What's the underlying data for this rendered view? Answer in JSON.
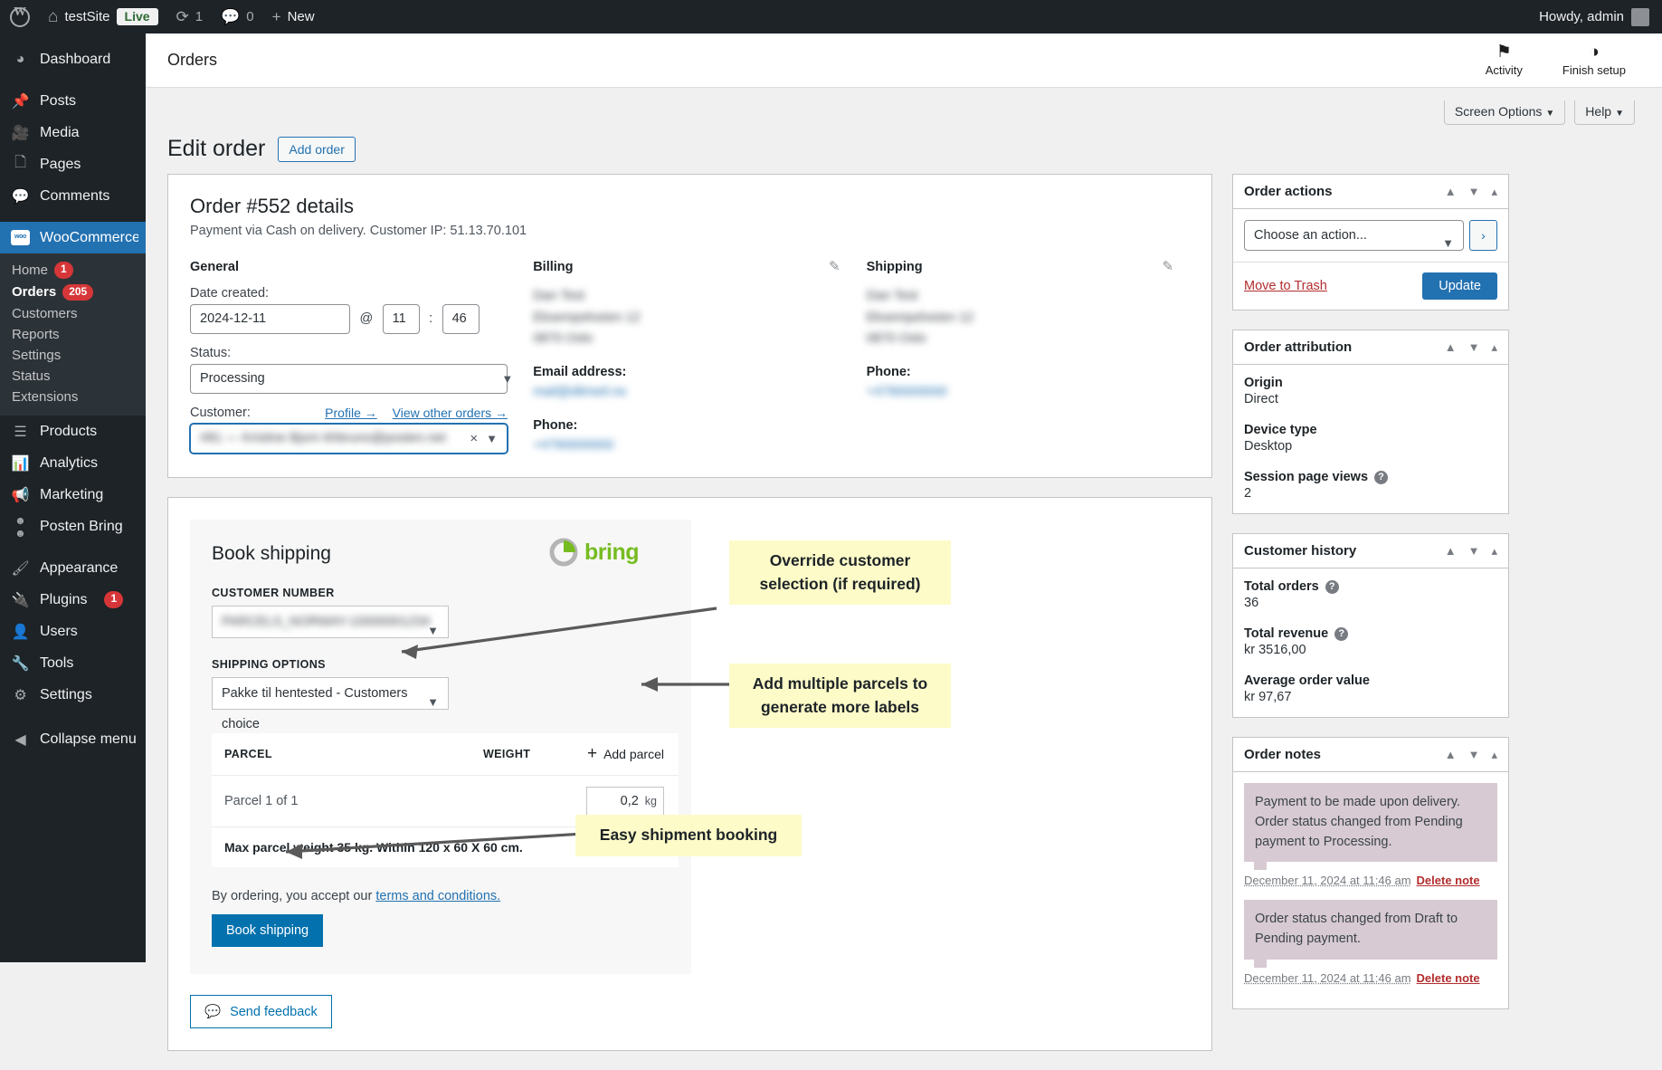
{
  "adminbar": {
    "site_name": "testSite",
    "live_badge": "Live",
    "updates_count": "1",
    "comments_count": "0",
    "new_label": "New",
    "howdy": "Howdy, admin"
  },
  "sidebar": {
    "items": [
      {
        "label": "Dashboard",
        "icon": "dashboard-icon"
      },
      {
        "label": "Posts",
        "icon": "pin-icon"
      },
      {
        "label": "Media",
        "icon": "media-icon"
      },
      {
        "label": "Pages",
        "icon": "pages-icon"
      },
      {
        "label": "Comments",
        "icon": "comment-icon"
      },
      {
        "label": "WooCommerce",
        "icon": "woo-icon",
        "selected": true
      },
      {
        "label": "Products",
        "icon": "products-icon"
      },
      {
        "label": "Analytics",
        "icon": "analytics-icon"
      },
      {
        "label": "Marketing",
        "icon": "megaphone-icon"
      },
      {
        "label": "Posten Bring",
        "icon": "posten-bring-icon"
      },
      {
        "label": "Appearance",
        "icon": "brush-icon"
      },
      {
        "label": "Plugins",
        "icon": "plug-icon",
        "badge": "1"
      },
      {
        "label": "Users",
        "icon": "users-icon"
      },
      {
        "label": "Tools",
        "icon": "tools-icon"
      },
      {
        "label": "Settings",
        "icon": "settings-icon"
      },
      {
        "label": "Collapse menu",
        "icon": "collapse-icon"
      }
    ],
    "submenu": [
      {
        "label": "Home",
        "badge": "1"
      },
      {
        "label": "Orders",
        "badge": "205",
        "current": true
      },
      {
        "label": "Customers"
      },
      {
        "label": "Reports"
      },
      {
        "label": "Settings"
      },
      {
        "label": "Status"
      },
      {
        "label": "Extensions"
      }
    ]
  },
  "woo_header": {
    "title": "Orders",
    "activity_label": "Activity",
    "finish_setup_label": "Finish setup"
  },
  "screen_options": {
    "screen_options_label": "Screen Options",
    "help_label": "Help",
    "caret": "▼"
  },
  "page": {
    "title": "Edit order",
    "add_order_label": "Add order"
  },
  "order_data": {
    "heading": "Order #552 details",
    "subheading": "Payment via Cash on delivery. Customer IP: 51.13.70.101",
    "general": {
      "heading": "General",
      "date_label": "Date created:",
      "date_value": "2024-12-11",
      "at_symbol": "@",
      "hour_value": "11",
      "colon": ":",
      "minute_value": "46",
      "status_label": "Status:",
      "status_value": "Processing",
      "customer_label": "Customer:",
      "profile_link": "Profile →",
      "view_orders_link": "View other orders →",
      "customer_value": "#81 — Kristine Bjorn khbruno@posten.net"
    },
    "billing": {
      "heading": "Billing",
      "address_lines": [
        "Dan Test",
        "Eksempelveien 12",
        "0870 Oslo"
      ],
      "email_label": "Email address:",
      "email_value": "mail@ditmeil.no",
      "phone_label": "Phone:",
      "phone_value": "+4790000000"
    },
    "shipping": {
      "heading": "Shipping",
      "address_lines": [
        "Dan Test",
        "Eksempelveien 12",
        "0870 Oslo"
      ],
      "phone_label": "Phone:",
      "phone_value": "+4790000000"
    }
  },
  "book_shipping": {
    "heading": "Book shipping",
    "brand": "bring",
    "customer_number_label": "CUSTOMER NUMBER",
    "customer_number_value": "PARCELS_NORWAY-10000001234",
    "shipping_options_label": "SHIPPING OPTIONS",
    "shipping_options_value": "Pakke til hentested - Customers choice",
    "table": {
      "columns": [
        "PARCEL",
        "WEIGHT"
      ],
      "add_parcel_label": "Add parcel",
      "rows": [
        {
          "parcel": "Parcel 1 of 1",
          "weight": "0,2",
          "unit": "kg"
        }
      ],
      "note": "Max parcel weight 35 kg. Within 120 x 60 X 60 cm."
    },
    "terms_prefix": "By ordering, you accept our ",
    "terms_link": "terms and conditions.",
    "book_button": "Book shipping",
    "feedback_button": "Send feedback"
  },
  "callouts": [
    {
      "line1": "Override customer",
      "line2": "selection (if required)"
    },
    {
      "line1": "Add multiple parcels to",
      "line2": "generate more labels"
    },
    {
      "line1": "Easy shipment booking",
      "line2": ""
    }
  ],
  "side_panels": {
    "order_actions": {
      "title": "Order actions",
      "select_value": "Choose an action...",
      "go_label": "›",
      "trash_label": "Move to Trash",
      "update_label": "Update"
    },
    "order_attribution": {
      "title": "Order attribution",
      "fields": [
        {
          "key": "Origin",
          "value": "Direct",
          "help": false
        },
        {
          "key": "Device type",
          "value": "Desktop",
          "help": false
        },
        {
          "key": "Session page views",
          "value": "2",
          "help": true
        }
      ]
    },
    "customer_history": {
      "title": "Customer history",
      "fields": [
        {
          "key": "Total orders",
          "value": "36",
          "help": true
        },
        {
          "key": "Total revenue",
          "value": "kr 3516,00",
          "help": true
        },
        {
          "key": "Average order value",
          "value": "kr 97,67",
          "help": false
        }
      ]
    },
    "order_notes": {
      "title": "Order notes",
      "notes": [
        {
          "body": "Payment to be made upon delivery. Order status changed from Pending payment to Processing.",
          "timestamp": "December 11, 2024 at 11:46 am",
          "delete_label": "Delete note"
        },
        {
          "body": "Order status changed from Draft to Pending payment.",
          "timestamp": "December 11, 2024 at 11:46 am",
          "delete_label": "Delete note"
        }
      ]
    }
  },
  "colors": {
    "wp_blue": "#2271b1",
    "woo_purple": "#7f54b3",
    "bring_green": "#76bc21",
    "danger_red": "#b32d2e",
    "badge_red": "#d63638",
    "callout_yellow": "#fdfbc8",
    "note_purple": "#d7cad2"
  }
}
